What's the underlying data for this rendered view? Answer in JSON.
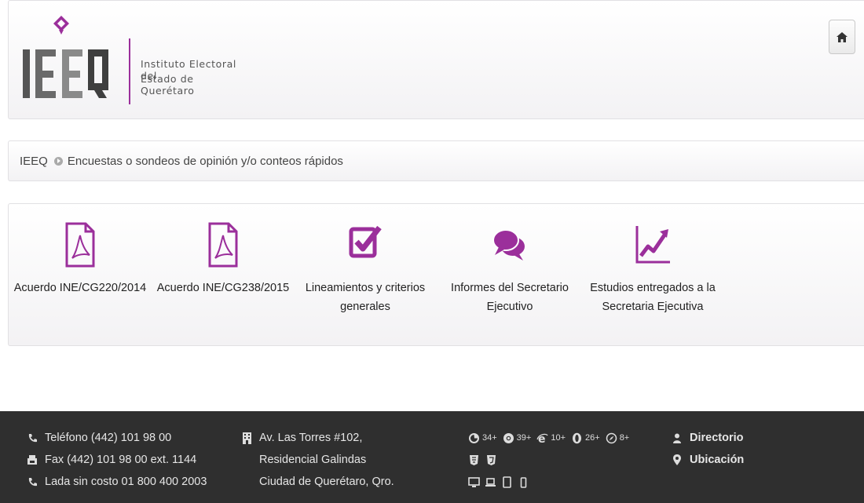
{
  "header": {
    "logo_lines": [
      "Instituto Electoral del",
      "Estado de Querétaro"
    ],
    "home_icon": "home-icon",
    "accent_color": "#9b2f9b"
  },
  "breadcrumb": {
    "root": "IEEQ",
    "current": "Encuestas o sondeos de opinión y/o conteos rápidos"
  },
  "documents": [
    {
      "icon": "pdf-icon",
      "lines": [
        "Acuerdo INE/CG220/2014"
      ]
    },
    {
      "icon": "pdf-icon",
      "lines": [
        "Acuerdo INE/CG238/2015"
      ]
    },
    {
      "icon": "checkbox-icon",
      "lines": [
        "Lineamientos y criterios",
        "generales"
      ]
    },
    {
      "icon": "chat-bubbles-icon",
      "lines": [
        "Informes del Secretario",
        "Ejecutivo"
      ]
    },
    {
      "icon": "trend-chart-icon",
      "lines": [
        "Estudios entregados a la",
        "Secretaria Ejecutiva"
      ]
    }
  ],
  "footer": {
    "contact": [
      "Teléfono (442) 101 98 00",
      "Fax (442) 101 98 00 ext. 1144",
      "Lada sin costo 01 800 400 2003"
    ],
    "address": [
      "Av. Las Torres #102,",
      "Residencial Galindas",
      "Ciudad de Querétaro, Qro."
    ],
    "browsers": [
      {
        "icon": "firefox-icon",
        "version": "34+"
      },
      {
        "icon": "chrome-icon",
        "version": "39+"
      },
      {
        "icon": "ie-icon",
        "version": "10+"
      },
      {
        "icon": "opera-icon",
        "version": "26+"
      },
      {
        "icon": "safari-icon",
        "version": "8+"
      }
    ],
    "links": [
      "Directorio",
      "Ubicación"
    ]
  }
}
